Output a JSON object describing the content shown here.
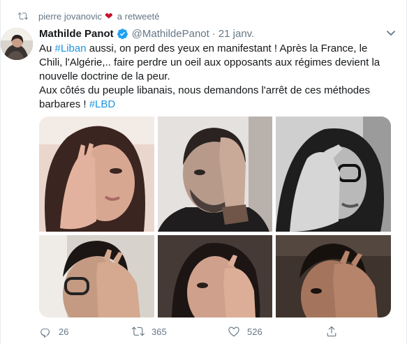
{
  "retweet": {
    "user": "pierre jovanovic",
    "heart": "❤",
    "suffix": "a retweeté",
    "icon": "retweet-icon"
  },
  "author": {
    "display_name": "Mathilde Panot",
    "verified": true,
    "handle": "@MathildePanot",
    "separator": "·",
    "date": "21 janv."
  },
  "tweet": {
    "line1_pre": "Au ",
    "hashtag1": "#Liban",
    "line1_post": " aussi, on perd des yeux en manifestant ! Après la France, le Chili, l'Algérie,.. faire perdre un oeil aux opposants aux régimes devient la nouvelle doctrine de la peur.",
    "line2_pre": "Aux côtés du peuple libanais, nous demandons l'arrêt de ces méthodes barbares ! ",
    "hashtag2": "#LBD"
  },
  "media": {
    "photos": [
      {
        "subject": "woman-covering-eye"
      },
      {
        "subject": "man-covering-eye"
      },
      {
        "subject": "woman-with-glasses-covering-eye"
      },
      {
        "subject": "man-with-glasses-covering-eye"
      },
      {
        "subject": "woman-covering-eye"
      },
      {
        "subject": "man-covering-eye"
      }
    ]
  },
  "actions": {
    "replies": "26",
    "retweets": "365",
    "likes": "526"
  },
  "colors": {
    "accent": "#1b95e0",
    "muted": "#657786",
    "text": "#14171a",
    "heart": "#c8102e"
  }
}
